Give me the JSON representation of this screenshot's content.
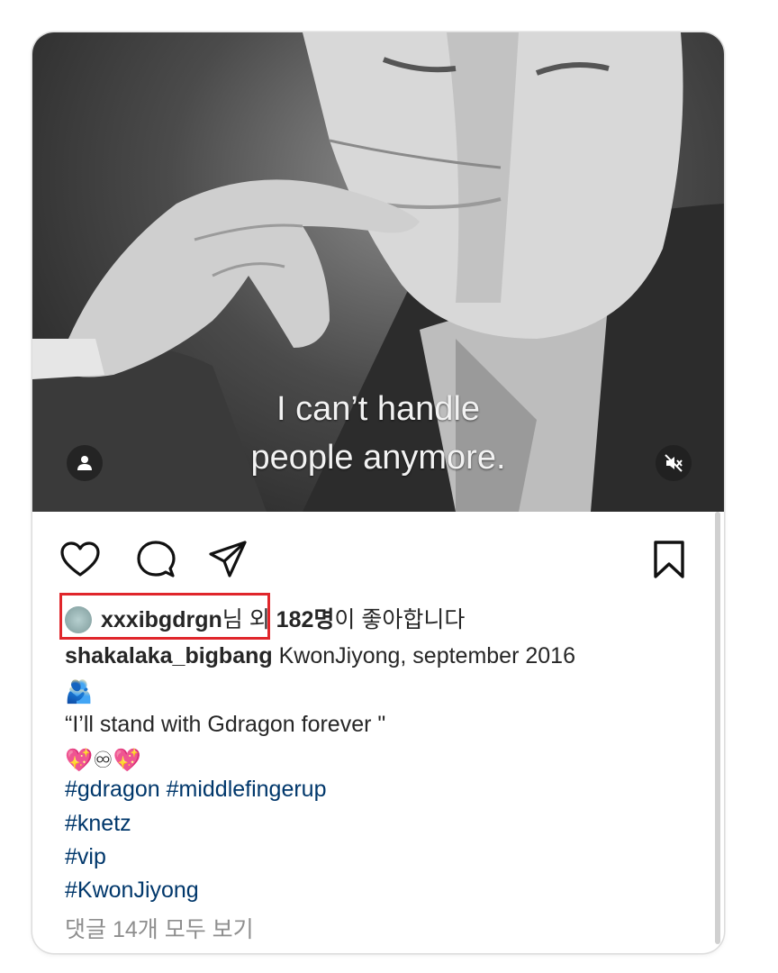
{
  "post": {
    "media": {
      "caption_line1": "I can’t handle",
      "caption_line2": "people anymore.",
      "icons": [
        "user-icon",
        "muted-speaker-icon"
      ]
    },
    "actions": {
      "icons": [
        "heart-icon",
        "comment-icon",
        "share-icon",
        "bookmark-icon"
      ]
    },
    "likes": {
      "username": "xxxibgdrgn",
      "suffix_nim": "님",
      "middle": " 외 ",
      "count": "182명",
      "tail": "이 좋아합니다"
    },
    "caption": {
      "author": "shakalaka_bigbang",
      "text": " KwonJiyong, september 2016",
      "emoji_line": "🫂",
      "quote": "“I’ll stand with Gdragon forever \"",
      "hearts_line": "💖♾💖",
      "hashtags": [
        "#gdragon #middlefingerup",
        "#knetz",
        "#vip",
        "#KwonJiyong"
      ]
    },
    "comments_link": "댓글 14개 모두 보기"
  },
  "colors": {
    "highlight_box": "#e0262b",
    "hashtag": "#00376b",
    "muted_text": "#8e8e8e"
  }
}
